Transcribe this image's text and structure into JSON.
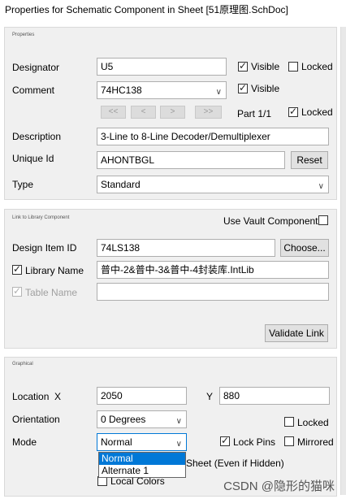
{
  "window": {
    "title": "Properties for Schematic Component in Sheet [51原理图.SchDoc]"
  },
  "properties": {
    "section_label": "Properties",
    "designator_label": "Designator",
    "designator_value": "U5",
    "designator_visible_label": "Visible",
    "designator_visible_checked": true,
    "designator_locked_label": "Locked",
    "designator_locked_checked": false,
    "comment_label": "Comment",
    "comment_value": "74HC138",
    "comment_visible_label": "Visible",
    "comment_visible_checked": true,
    "nav_first": "<<",
    "nav_prev": "<",
    "nav_next": ">",
    "nav_last": ">>",
    "part_label": "Part 1/1",
    "part_locked_label": "Locked",
    "part_locked_checked": true,
    "description_label": "Description",
    "description_value": "3-Line to 8-Line Decoder/Demultiplexer",
    "unique_id_label": "Unique Id",
    "unique_id_value": "AHONTBGL",
    "reset_label": "Reset",
    "type_label": "Type",
    "type_value": "Standard"
  },
  "library": {
    "section_label": "Link to Library Component",
    "use_vault_label": "Use Vault Component",
    "use_vault_checked": false,
    "design_item_label": "Design Item ID",
    "design_item_value": "74LS138",
    "choose_label": "Choose...",
    "library_name_label": "Library Name",
    "library_name_checked": true,
    "library_name_value": "普中-2&普中-3&普中-4封装库.IntLib",
    "table_name_label": "Table Name",
    "table_name_checked": true,
    "table_name_value": "",
    "validate_label": "Validate Link"
  },
  "graphical": {
    "section_label": "Graphical",
    "location_label": "Location",
    "x_label": "X",
    "x_value": "2050",
    "y_label": "Y",
    "y_value": "880",
    "orientation_label": "Orientation",
    "orientation_value": "0 Degrees",
    "orientation_locked_label": "Locked",
    "orientation_locked_checked": false,
    "mode_label": "Mode",
    "mode_value": "Normal",
    "mode_options": [
      "Normal",
      "Alternate 1"
    ],
    "lock_pins_label": "Lock Pins",
    "lock_pins_checked": true,
    "mirrored_label": "Mirrored",
    "mirrored_checked": false,
    "show_all_pins_partial": "Sheet (Even if Hidden)",
    "local_colors_label": "Local Colors",
    "local_colors_checked": false
  },
  "watermark": "CSDN @隐形的猫咪"
}
